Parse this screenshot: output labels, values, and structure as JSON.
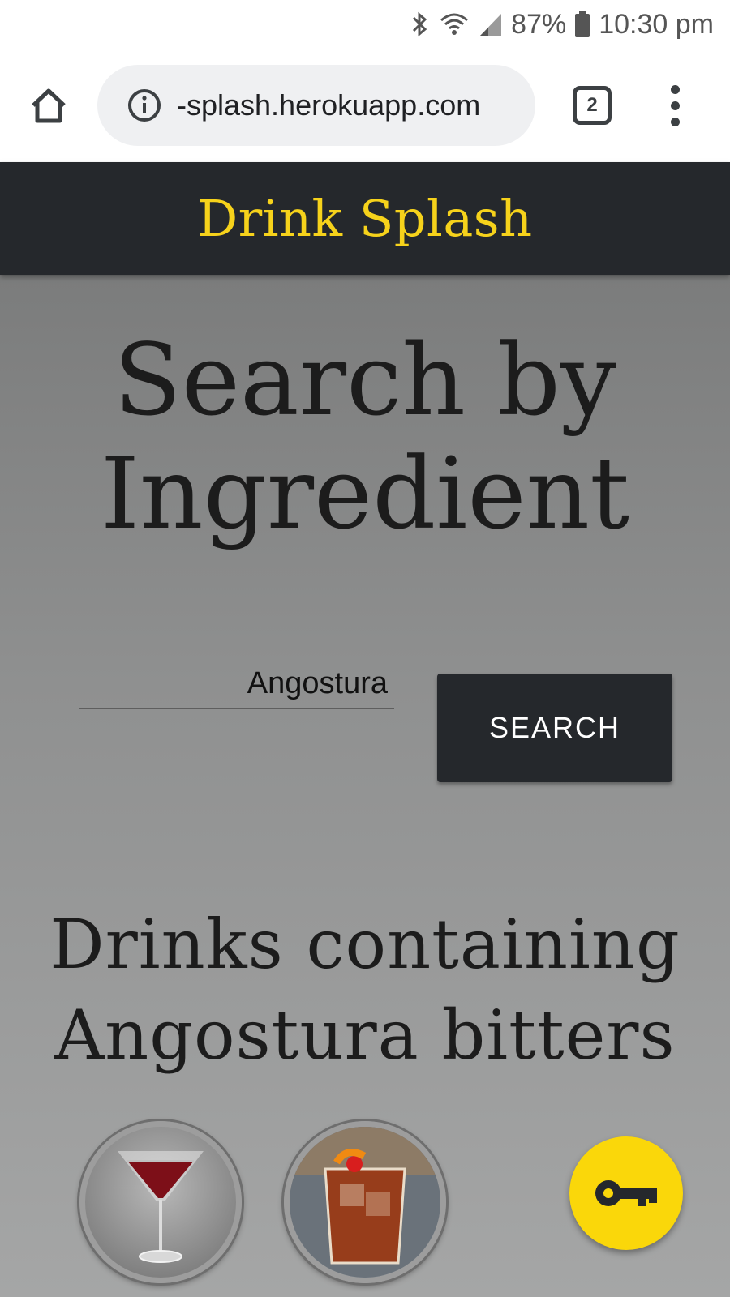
{
  "status_bar": {
    "battery": "87%",
    "time": "10:30 pm"
  },
  "browser": {
    "url": "-splash.herokuapp.com",
    "tab_count": "2"
  },
  "navbar": {
    "brand": "Drink Splash"
  },
  "main": {
    "heading": "Search by Ingredient",
    "search": {
      "value": "Angostura",
      "button_label": "SEARCH"
    },
    "results_heading": "Drinks containing Angostura bitters"
  },
  "colors": {
    "brand_yellow": "#f6d21b",
    "navbar_bg": "#25282c",
    "fab_yellow": "#fad70a"
  },
  "icons": [
    "bluetooth-icon",
    "wifi-icon",
    "signal-icon",
    "battery-icon",
    "home-icon",
    "info-icon",
    "tabs-icon",
    "more-vert-icon",
    "key-icon"
  ]
}
